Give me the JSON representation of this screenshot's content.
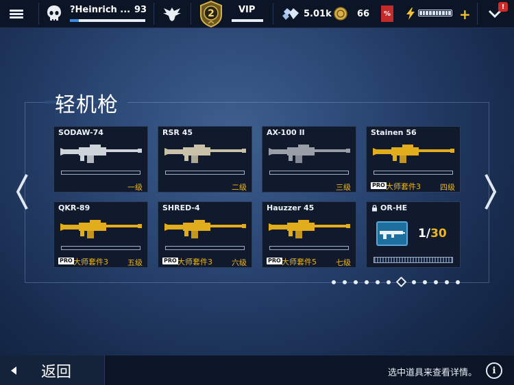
{
  "header": {
    "player_name": "?Heinrich ...",
    "player_level": "93",
    "xp_progress": 0.12,
    "rank": "2",
    "vip_label": "VIP",
    "gems": "5.01k",
    "coins": "66",
    "sale_badge": "%",
    "energy_level": 1.0,
    "add_label": "+",
    "alert": "!"
  },
  "section": {
    "title": "轻机枪"
  },
  "weapons": [
    {
      "name": "SODAW-74",
      "level": "一级",
      "pro": "",
      "kit": "",
      "color": "#cfd4da"
    },
    {
      "name": "RSR 45",
      "level": "二级",
      "pro": "",
      "kit": "",
      "color": "#c9c2a8"
    },
    {
      "name": "AX-100 II",
      "level": "三级",
      "pro": "",
      "kit": "",
      "color": "#9a9ea6"
    },
    {
      "name": "Stainen 56",
      "level": "四级",
      "pro": "PRO",
      "kit": "大师套件3",
      "color": "#e2ad1d"
    },
    {
      "name": "QKR-89",
      "level": "五级",
      "pro": "PRO",
      "kit": "大师套件3",
      "color": "#e2ad1d"
    },
    {
      "name": "SHRED-4",
      "level": "六级",
      "pro": "PRO",
      "kit": "大师套件3",
      "color": "#e2ad1d"
    },
    {
      "name": "Hauzzer 45",
      "level": "七级",
      "pro": "PRO",
      "kit": "大师套件5",
      "color": "#e2ad1d"
    }
  ],
  "locked_weapon": {
    "name": "OR-HE",
    "blueprints_have": "1",
    "blueprints_sep": "/",
    "blueprints_need": "30"
  },
  "pagination": {
    "total": 12,
    "active": 7
  },
  "footer": {
    "back_label": "返回",
    "hint": "选中道具来查看详情。",
    "info": "i"
  }
}
